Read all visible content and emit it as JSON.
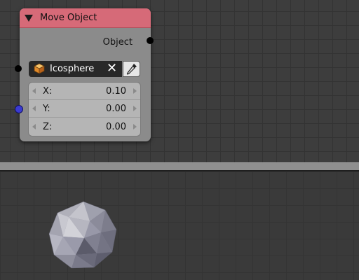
{
  "node": {
    "title": "Move Object",
    "header_color": "#d66a78",
    "output_label": "Object",
    "object_field": {
      "value": "Icosphere",
      "icon": "cube-icon",
      "clear_icon": "close-icon",
      "picker_icon": "eyedropper-icon"
    },
    "vector": [
      {
        "label": "X:",
        "value": "0.10"
      },
      {
        "label": "Y:",
        "value": "0.00"
      },
      {
        "label": "Z:",
        "value": "0.00"
      }
    ],
    "sockets": {
      "object_color": "#000000",
      "vector_color": "#3b3bd0"
    }
  },
  "viewport": {
    "object": "icosphere"
  }
}
